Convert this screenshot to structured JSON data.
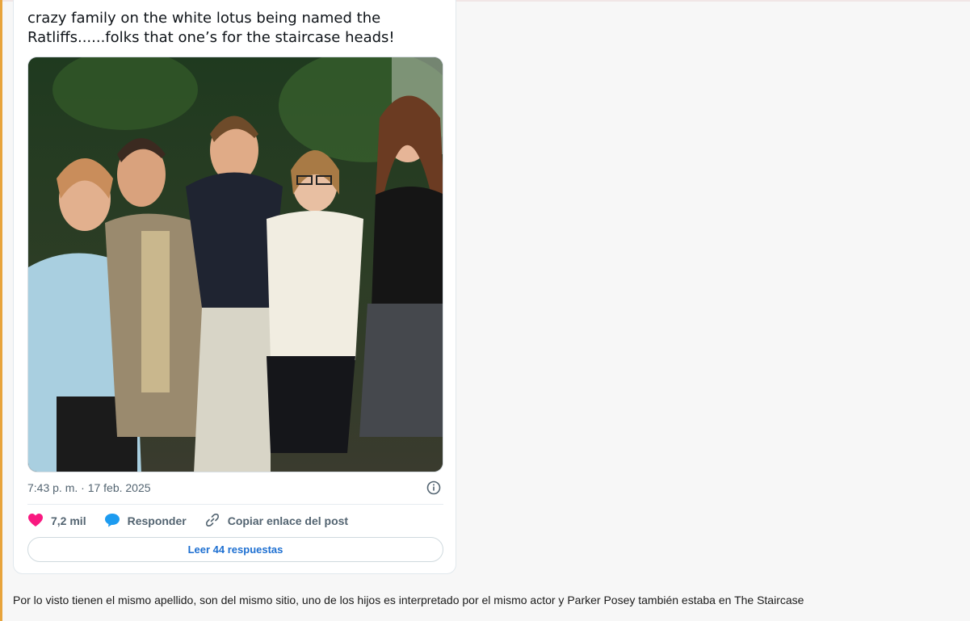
{
  "tweet": {
    "text": "crazy family on the white lotus being named the\nRatliffs......folks that one’s for the staircase heads!",
    "timestamp": "7:43 p. m. · 17 feb. 2025",
    "likes": "7,2 mil",
    "reply_label": "Responder",
    "copy_link_label": "Copiar enlace del post",
    "read_replies_label": "Leer 44 respuestas",
    "icons": {
      "info": "info-icon",
      "like": "heart-icon",
      "reply": "speech-bubble-icon",
      "copy": "link-icon"
    },
    "colors": {
      "like": "#f91880",
      "reply": "#1d9bf0",
      "link": "#1d6fd1"
    }
  },
  "comment": {
    "text": "Por lo visto tienen el mismo apellido, son del mismo sitio, uno de los hijos es interpretado por el mismo actor y Parker Posey también estaba en The Staircase"
  },
  "accent_color": "#e8a43c"
}
